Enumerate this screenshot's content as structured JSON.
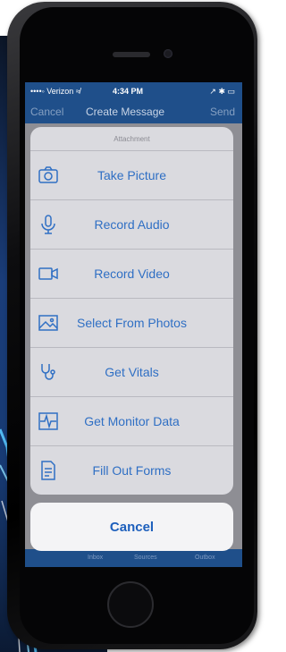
{
  "status_bar": {
    "carrier": "••••◦ Verizon ≉",
    "time": "4:34 PM",
    "right": "↗ ✱ ▭"
  },
  "nav": {
    "cancel": "Cancel",
    "title": "Create Message",
    "send": "Send"
  },
  "action_sheet": {
    "header": "Attachment",
    "items": [
      {
        "label": "Take Picture",
        "icon": "camera-icon"
      },
      {
        "label": "Record Audio",
        "icon": "microphone-icon"
      },
      {
        "label": "Record Video",
        "icon": "video-camera-icon"
      },
      {
        "label": "Select From Photos",
        "icon": "photo-icon"
      },
      {
        "label": "Get Vitals",
        "icon": "stethoscope-icon"
      },
      {
        "label": "Get Monitor Data",
        "icon": "monitor-waveform-icon"
      },
      {
        "label": "Fill Out Forms",
        "icon": "document-icon"
      }
    ],
    "cancel": "Cancel"
  },
  "bottom_tabs": [
    "Inbox",
    "Sources",
    "Outbox"
  ],
  "colors": {
    "accent": "#2f6fc4",
    "nav_bar": "#1f4f8a"
  }
}
